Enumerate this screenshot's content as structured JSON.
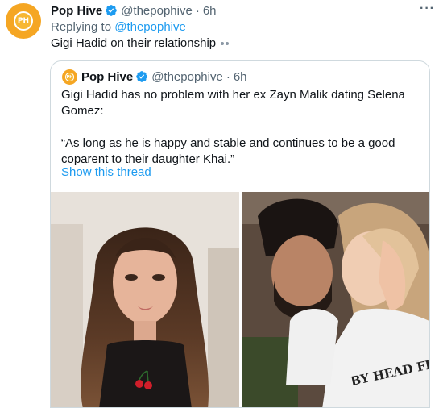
{
  "tweet": {
    "author_name": "Pop Hive",
    "handle": "@thepophive",
    "separator": "·",
    "time": "6h",
    "more_label": "···",
    "reply_prefix": "Replying to",
    "reply_handle": "@thepophive",
    "text": "Gigi Hadid on their relationship"
  },
  "quote": {
    "author_name": "Pop Hive",
    "handle": "@thepophive",
    "separator": "·",
    "time": "6h",
    "text_line1": "Gigi Hadid has no problem with her ex Zayn Malik dating Selena Gomez:",
    "text_line2": "“As long as he is happy and stable and continues to be a good coparent to their daughter Khai.”",
    "show_thread": "Show this thread"
  },
  "photos": {
    "right_shirt_text": "BY HEAD FIRE CO."
  },
  "colors": {
    "accent": "#1d9bf0",
    "muted": "#536471",
    "avatar": "#f5a623"
  },
  "icons": {
    "avatar": "pophive-logo",
    "verified": "verified-badge-icon",
    "more": "more-options-icon"
  }
}
